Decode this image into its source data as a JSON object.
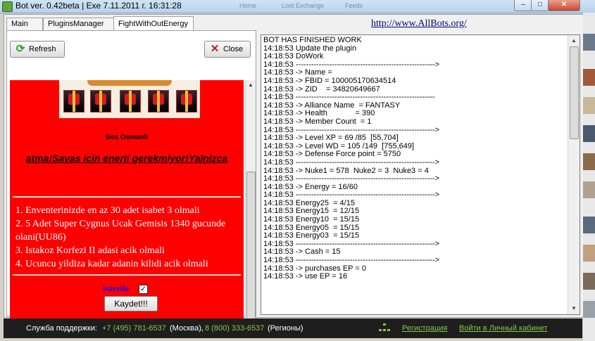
{
  "window": {
    "title": "Bot ver. 0.42beta | Exe 7.11.2011 г. 16:31:28",
    "background_tabs": [
      "Home",
      "Loot Exchange",
      "Feeds"
    ]
  },
  "tabs": [
    {
      "label": "Main",
      "active": false
    },
    {
      "label": "PluginsManager",
      "active": false
    },
    {
      "label": "FightWithOutEnergy",
      "active": true
    }
  ],
  "toolbar": {
    "refresh_label": "Refresh",
    "close_label": "Close"
  },
  "panel": {
    "author": "Soa Osmanli",
    "warning": "atma!Savas icin enerji gerekmiyor!Yalnizca",
    "rules": [
      "1. Enventerinizde en az 30 adet isabet 3 olmali",
      "2. 5 Adet Super Cygnus Ucak Gemisis 1340 gucunde olani(UU86)",
      "3. Istakoz Korfezi II adasi acik olmali",
      "4. Ucuncu yildiza kadar adanin kilidi acik olmali"
    ],
    "checkbox_label": "isaretle",
    "checkbox_checked": true,
    "save_label": "Kaydet!!!"
  },
  "link": {
    "url_text": "http://www.AllBots.org/"
  },
  "log": [
    "BOT HAS FINISHED WORK",
    "14:18:53 Update the plugin",
    "14:18:53 DoWork",
    "14:18:53 ------------------------------------------------------>",
    "14:18:53 -> Name =",
    "14:18:53 -> FBID = 100005170634514",
    "14:18:53 -> ZID    = 34820649667",
    "14:18:53 ------------------------------------------------------",
    "14:18:53 -> Alliance Name  = FANTASY",
    "14:18:53 -> Health             = 390",
    "14:18:53 -> Member Count  = 1",
    "14:18:53 ------------------------------------------------------>",
    "14:18:53 -> Level XP = 69 /85  [55,704]",
    "14:18:53 -> Level WD = 105 /149  [755,649]",
    "14:18:53 -> Defense Force point = 5750",
    "14:18:53 ------------------------------------------------------>",
    "14:18:53 -> Nuke1 = 578  Nuke2 = 3  Nuke3 = 4",
    "14:18:53 ------------------------------------------------------>",
    "14:18:53 -> Energy = 16/60",
    "14:18:53 ------------------------------------------------------>",
    "14:18:53 Energy25  = 4/15",
    "14:18:53 Energy15  = 12/15",
    "14:18:53 Energy10  = 15/15",
    "14:18:53 Energy05  = 15/15",
    "14:18:53 Energy03  = 15/15",
    "14:18:53 ------------------------------------------------------>",
    "14:18:53 -> Cash = 15",
    "14:18:53 ------------------------------------------------------>",
    "14:18:53 -> purchases EP = 0",
    "14:18:53 -> use EP = 16"
  ],
  "footer": {
    "support_label": "Служба поддержки:",
    "phone1": "+7 (495) 781-6537",
    "city1": "(Москва),",
    "phone2": "8 (800) 333-6537",
    "city2": "(Регионы)",
    "register": "Регистрация",
    "cabinet": "Войти в Личный кабинет"
  },
  "colors": {
    "panel_red": "#ff0000",
    "footer_bg": "#1e1e1e",
    "footer_green": "#8bc34a",
    "link_blue": "#000080"
  }
}
